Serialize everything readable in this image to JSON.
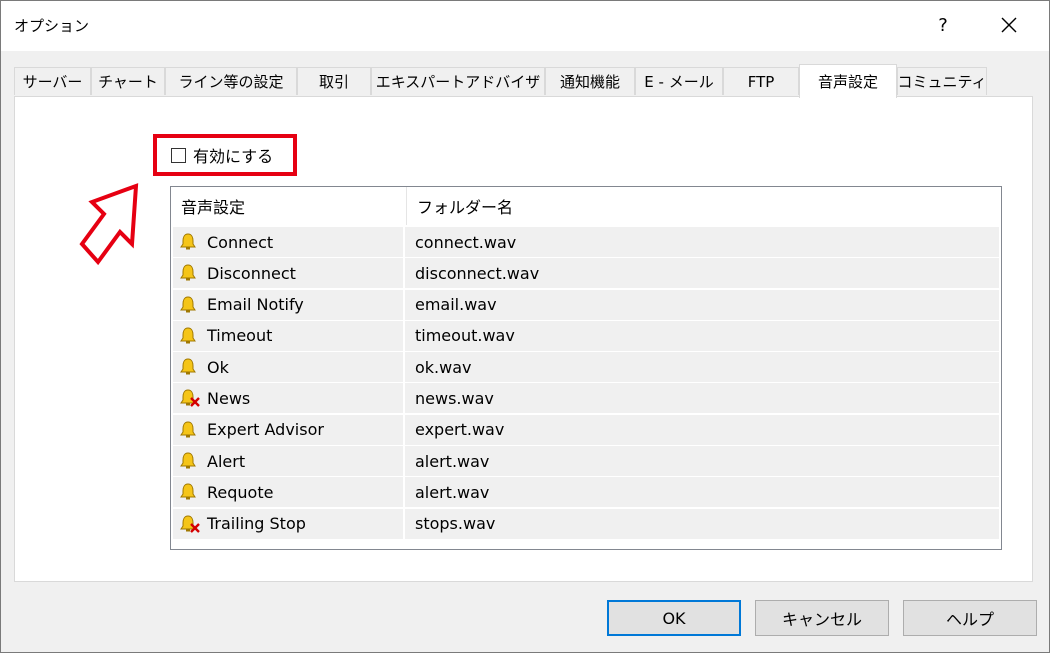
{
  "window": {
    "title": "オプション",
    "help_label": "?"
  },
  "tabs": [
    {
      "label": "サーバー",
      "active": false
    },
    {
      "label": "チャート",
      "active": false
    },
    {
      "label": "ライン等の設定",
      "active": false
    },
    {
      "label": "取引",
      "active": false
    },
    {
      "label": "エキスパートアドバイザ",
      "active": false
    },
    {
      "label": "通知機能",
      "active": false
    },
    {
      "label": "E - メール",
      "active": false
    },
    {
      "label": "FTP",
      "active": false
    },
    {
      "label": "音声設定",
      "active": true
    },
    {
      "label": "コミュニティ",
      "active": false
    }
  ],
  "enable": {
    "label": "有効にする",
    "checked": false,
    "highlight_color": "#e60012"
  },
  "table": {
    "columns": [
      "音声設定",
      "フォルダー名"
    ],
    "rows": [
      {
        "event": "Connect",
        "file": "connect.wav",
        "icon": "bell-icon"
      },
      {
        "event": "Disconnect",
        "file": "disconnect.wav",
        "icon": "bell-icon"
      },
      {
        "event": "Email Notify",
        "file": "email.wav",
        "icon": "bell-icon"
      },
      {
        "event": "Timeout",
        "file": "timeout.wav",
        "icon": "bell-icon"
      },
      {
        "event": "Ok",
        "file": "ok.wav",
        "icon": "bell-icon"
      },
      {
        "event": "News",
        "file": "news.wav",
        "icon": "bell-disabled-icon"
      },
      {
        "event": "Expert Advisor",
        "file": "expert.wav",
        "icon": "bell-icon"
      },
      {
        "event": "Alert",
        "file": "alert.wav",
        "icon": "bell-icon"
      },
      {
        "event": "Requote",
        "file": "alert.wav",
        "icon": "bell-icon"
      },
      {
        "event": "Trailing Stop",
        "file": "stops.wav",
        "icon": "bell-disabled-icon"
      }
    ]
  },
  "buttons": {
    "ok": "OK",
    "cancel": "キャンセル",
    "help": "ヘルプ"
  },
  "colors": {
    "accent": "#0078d7",
    "annotation": "#e60012",
    "bell": "#f5c518"
  }
}
